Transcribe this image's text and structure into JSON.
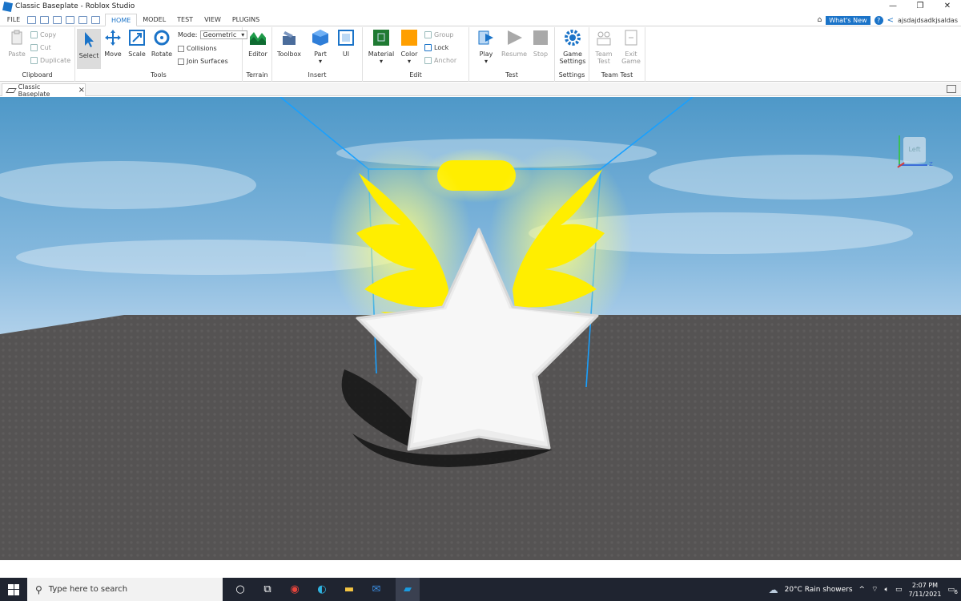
{
  "window": {
    "title": "Classic Baseplate - Roblox Studio"
  },
  "menu": {
    "file": "FILE",
    "tabs": [
      "HOME",
      "MODEL",
      "TEST",
      "VIEW",
      "PLUGINS"
    ],
    "whats_new": "What's New",
    "help": "?",
    "username": "ajsdajdsadkjsaldas"
  },
  "ribbon": {
    "clipboard": {
      "label": "Clipboard",
      "paste": "Paste",
      "copy": "Copy",
      "cut": "Cut",
      "duplicate": "Duplicate"
    },
    "tools": {
      "label": "Tools",
      "select": "Select",
      "move": "Move",
      "scale": "Scale",
      "rotate": "Rotate",
      "mode_label": "Mode:",
      "mode_value": "Geometric",
      "collisions": "Collisions",
      "join_surfaces": "Join Surfaces"
    },
    "terrain": {
      "label": "Terrain",
      "editor": "Editor"
    },
    "insert": {
      "label": "Insert",
      "toolbox": "Toolbox",
      "part": "Part",
      "ui": "UI"
    },
    "edit": {
      "label": "Edit",
      "material": "Material",
      "color": "Color",
      "group": "Group",
      "lock": "Lock",
      "anchor": "Anchor"
    },
    "test": {
      "label": "Test",
      "play": "Play",
      "resume": "Resume",
      "stop": "Stop"
    },
    "settings": {
      "label": "Settings",
      "game_settings_1": "Game",
      "game_settings_2": "Settings"
    },
    "team_test": {
      "label": "Team Test",
      "team_test_1": "Team",
      "team_test_2": "Test",
      "exit_game_1": "Exit",
      "exit_game_2": "Game"
    }
  },
  "document_tab": {
    "label": "Classic Baseplate",
    "close": "×"
  },
  "viewport": {
    "view_cube_label": "Left",
    "axis_z": "Z"
  },
  "taskbar": {
    "search_placeholder": "Type here to search",
    "weather": "20°C  Rain showers",
    "time": "2:07 PM",
    "date": "7/11/2021",
    "notification_count": "6"
  },
  "colors": {
    "accent": "#1a73c8",
    "wing": "#ffee00",
    "sky": "#86b9de",
    "floor": "#535151"
  }
}
